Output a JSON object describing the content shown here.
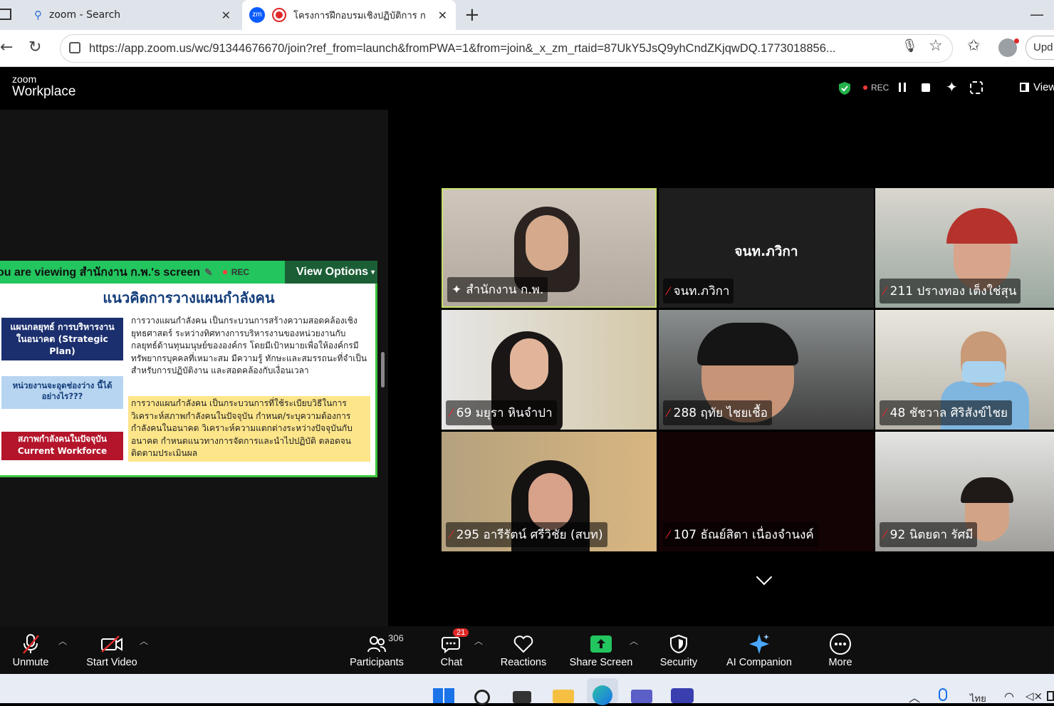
{
  "browser": {
    "tabs": [
      {
        "label": "zoom - Search",
        "active": false
      },
      {
        "label": "โครงการฝึกอบรมเชิงปฏิบัติการ ก",
        "active": true
      }
    ],
    "url": "https://app.zoom.us/wc/91344676670/join?ref_from=launch&fromPWA=1&from=join&_x_zm_rtaid=87UkY5JsQ9yhCndZKjqwDQ.1773018856...",
    "update_label": "Upd"
  },
  "zoom": {
    "logo_top": "zoom",
    "logo_bottom": "Workplace",
    "rec_label": "REC",
    "view_label": "View",
    "share_banner": {
      "viewing_text": "ou are viewing สำนักงาน ก.พ.'s screen",
      "rec_label": "REC",
      "view_options": "View Options"
    },
    "slide": {
      "title": "แนวคิดการวางแผนกำลังคน",
      "box1": "แผนกลยุทธ์ การบริหารงานในอนาคต (Strategic Plan)",
      "box2": "หน่วยงานจะอุดช่องว่าง นี้ได้อย่างไร???",
      "box3": "สภาพกำลังคนในปัจจุบัน Current Workforce",
      "para1": "การวางแผนกำลังคน เป็นกระบวนการสร้างความสอดคล้องเชิงยุทธศาสตร์ ระหว่างทิศทางการบริหารงานของหน่วยงานกับกลยุทธ์ด้านทุนมนุษย์ขององค์กร โดยมีเป้าหมายเพื่อให้องค์กรมีทรัพยากรบุคคลที่เหมาะสม มีความรู้ ทักษะและสมรรถนะที่จำเป็น สำหรับการปฏิบัติงาน และสอดคล้องกับเงื่อนเวลา",
      "para2": "การวางแผนกำลังคน เป็นกระบวนการที่ใช้ระเบียบวิธีในการวิเคราะห์สภาพกำลังคนในปัจจุบัน กำหนด/ระบุความต้องการกำลังคนในอนาคต วิเคราะห์ความแตกต่างระหว่างปัจจุบันกับอนาคต กำหนดแนวทางการจัดการและนำไปปฏิบัติ ตลอดจนติดตามประเมินผล"
    },
    "participants_tiles": [
      {
        "name": "สำนักงาน ก.พ.",
        "muted": false,
        "active_speaker": true
      },
      {
        "name": "จนท.ภวิกา",
        "muted": true,
        "center_name": "จนท.ภวิกา"
      },
      {
        "name": "211 ปรางทอง เต็งใช่สุน",
        "muted": true
      },
      {
        "name": "69 มยุรา หินจำปา",
        "muted": true
      },
      {
        "name": "288 ฤทัย ไชยเชื้อ",
        "muted": true
      },
      {
        "name": "48 ชัชวาล ศิริสังข์ไชย",
        "muted": true
      },
      {
        "name": "295 อารีรัตน์ ศรีวิชัย (สบท)",
        "muted": true
      },
      {
        "name": "107 ธัณย์สิตา เนื่องจำนงค์",
        "muted": true
      },
      {
        "name": "92 นิตยดา รัศมี",
        "muted": true
      }
    ],
    "toolbar": {
      "unmute": "Unmute",
      "start_video": "Start Video",
      "participants": "Participants",
      "participants_count": "306",
      "chat": "Chat",
      "chat_badge": "21",
      "reactions": "Reactions",
      "share_screen": "Share Screen",
      "security": "Security",
      "ai_companion": "AI Companion",
      "more": "More"
    }
  },
  "taskbar": {
    "lang": "ไทย"
  },
  "colors": {
    "share_green": "#22c55e",
    "active_speaker_border": "#c6e06a",
    "mute_red": "#e02828",
    "rec_red": "#ff3b3b",
    "zoom_blue": "#0b5cff"
  }
}
